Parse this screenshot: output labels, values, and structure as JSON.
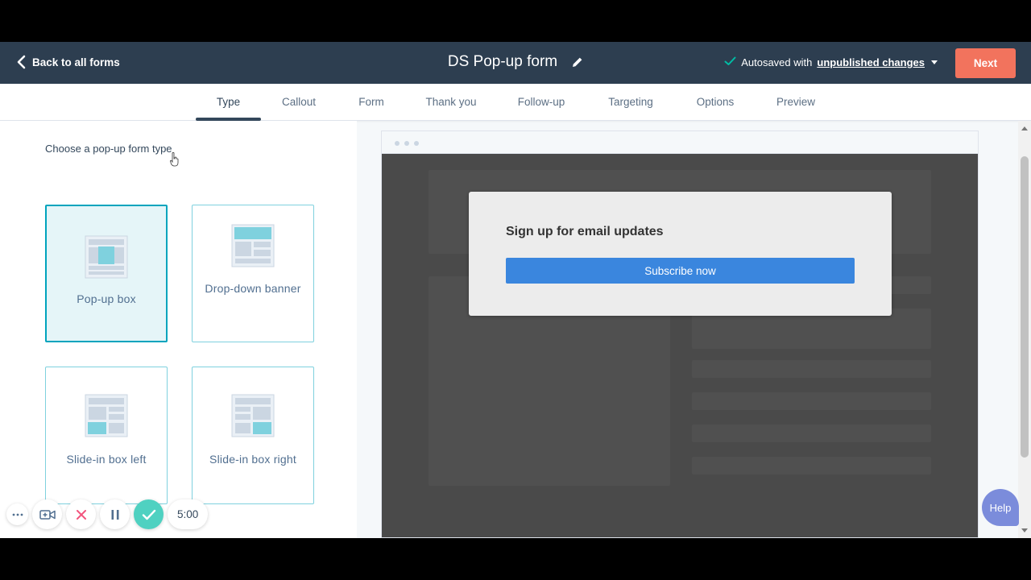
{
  "header": {
    "back_label": "Back to all forms",
    "form_title": "DS Pop-up form",
    "autosave_prefix": "Autosaved with",
    "autosave_link": "unpublished changes",
    "next_label": "Next"
  },
  "tabs": [
    {
      "label": "Type",
      "active": true
    },
    {
      "label": "Callout",
      "active": false
    },
    {
      "label": "Form",
      "active": false
    },
    {
      "label": "Thank you",
      "active": false
    },
    {
      "label": "Follow-up",
      "active": false
    },
    {
      "label": "Targeting",
      "active": false
    },
    {
      "label": "Options",
      "active": false
    },
    {
      "label": "Preview",
      "active": false
    }
  ],
  "left": {
    "choose_label": "Choose a pop-up form type",
    "types": [
      {
        "label": "Pop-up box",
        "selected": true,
        "icon": "popup-box-icon"
      },
      {
        "label": "Drop-down banner",
        "selected": false,
        "icon": "dropdown-banner-icon"
      },
      {
        "label": "Slide-in box left",
        "selected": false,
        "icon": "slide-in-left-icon"
      },
      {
        "label": "Slide-in box right",
        "selected": false,
        "icon": "slide-in-right-icon"
      }
    ]
  },
  "preview": {
    "popup_title": "Sign up for email updates",
    "button_label": "Subscribe now"
  },
  "recorder": {
    "time": "5:00"
  },
  "help_label": "Help",
  "colors": {
    "header_bg": "#2d3e50",
    "accent_teal": "#00a4bd",
    "next_button": "#f2735d",
    "subscribe_button": "#3a86de",
    "help_button": "#7b8cdb",
    "recorder_done": "#4fd1c1"
  }
}
